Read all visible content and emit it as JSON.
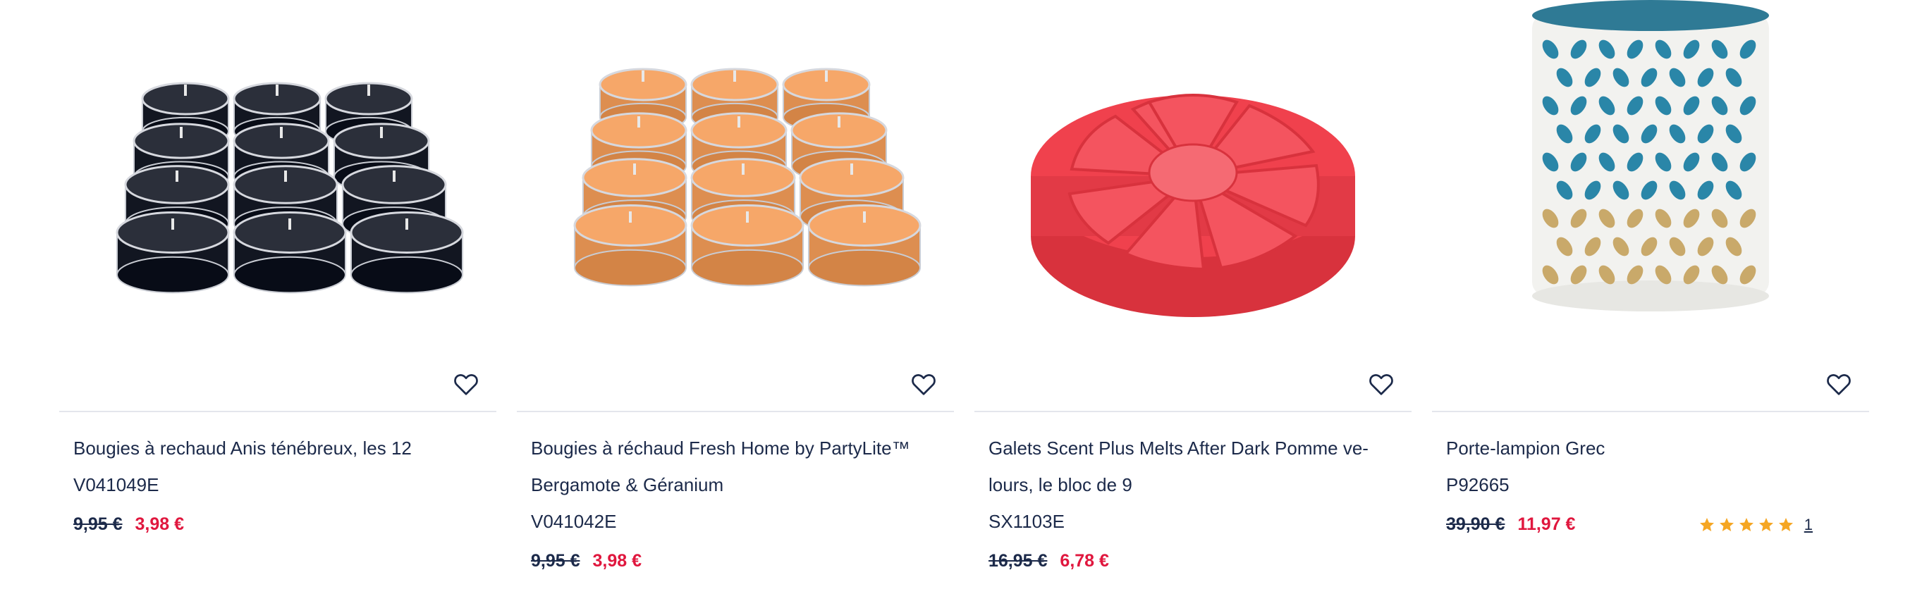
{
  "products": [
    {
      "name": "Bougies à rechaud Anis ténébreux, les 12",
      "sku": "V041049E",
      "old_price": "9,95 €",
      "new_price": "3,98 €",
      "image_icon": "black-tealights-icon",
      "candle_color": "#2b2f3a"
    },
    {
      "name": "Bougies à réchaud Fresh Home by PartyLite™ Bergamote & Géranium",
      "sku": "V041042E",
      "old_price": "9,95 €",
      "new_price": "3,98 €",
      "image_icon": "orange-tealights-icon",
      "candle_color": "#f6a769"
    },
    {
      "name": "Galets Scent Plus Melts After Dark Pomme ve-lours, le bloc de 9",
      "sku": "SX1103E",
      "old_price": "16,95 €",
      "new_price": "6,78 €",
      "image_icon": "red-wax-melt-icon",
      "candle_color": "#f0414d"
    },
    {
      "name": "Porte-lampion Grec",
      "sku": "P92665",
      "old_price": "39,90 €",
      "new_price": "11,97 €",
      "image_icon": "votive-holder-icon",
      "rating": 5,
      "review_count": "1",
      "star_color": "#f5a623"
    }
  ],
  "colors": {
    "accent_red": "#e0173e",
    "text_navy": "#1c2a4a",
    "divider": "#e4e6ec"
  }
}
